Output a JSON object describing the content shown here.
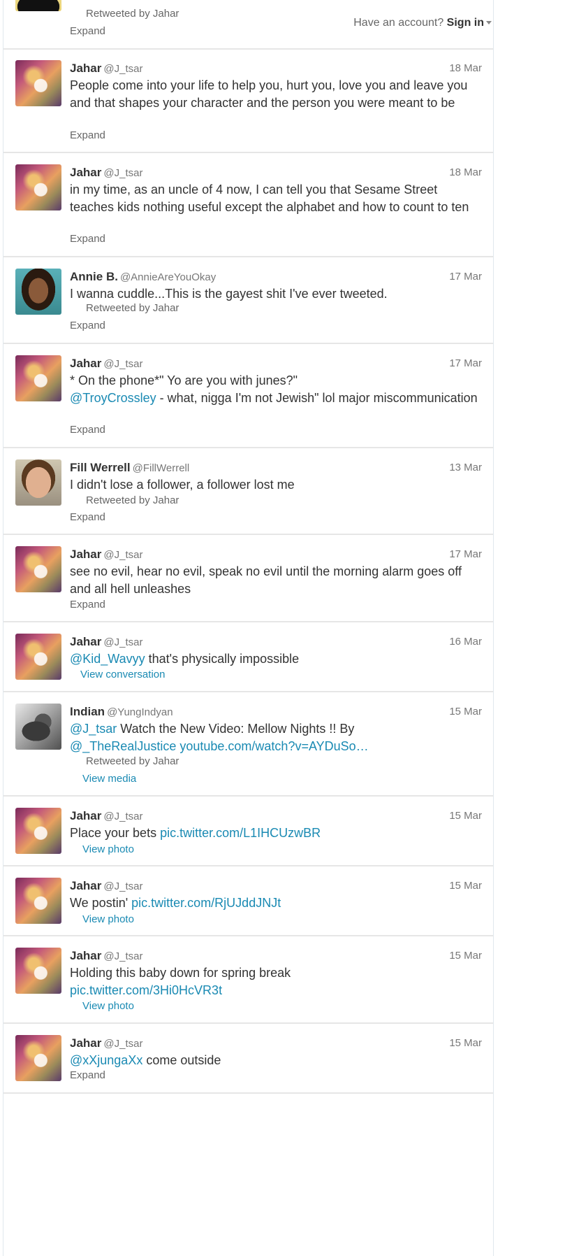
{
  "signin": {
    "prompt": "Have an account?",
    "link": "Sign in"
  },
  "top_partial": {
    "retweeted_by": "Retweeted by Jahar",
    "expand": "Expand"
  },
  "tweets": [
    {
      "fullname": "Jahar",
      "username": "@J_tsar",
      "time": "18 Mar",
      "text": "People come into your life to help you, hurt you, love you and leave you and that shapes your character and the person you were meant to be",
      "expand": "Expand"
    },
    {
      "fullname": "Jahar",
      "username": "@J_tsar",
      "time": "18 Mar",
      "text": "in my time, as an uncle of 4 now, I can tell you that Sesame Street teaches kids nothing useful except the alphabet and how to count to ten",
      "expand": "Expand"
    },
    {
      "fullname": "Annie B.",
      "username": "@AnnieAreYouOkay",
      "time": "17 Mar",
      "text": "I wanna cuddle...This is the gayest shit I've ever tweeted.",
      "retweeted_by": "Retweeted by Jahar",
      "expand": "Expand"
    },
    {
      "fullname": "Jahar",
      "username": "@J_tsar",
      "time": "17 Mar",
      "text_a": "* On the phone*\" Yo are you with junes?\"",
      "mention": "@TroyCrossley",
      "text_b": " - what, nigga I'm not Jewish\" lol major miscommunication",
      "expand": "Expand"
    },
    {
      "fullname": "Fill Werrell",
      "username": "@FillWerrell",
      "time": "13 Mar",
      "text": "I didn't lose a follower, a follower lost me",
      "retweeted_by": "Retweeted by Jahar",
      "expand": "Expand"
    },
    {
      "fullname": "Jahar",
      "username": "@J_tsar",
      "time": "17 Mar",
      "text": "see no evil, hear no evil, speak no evil until the morning alarm goes off and all hell unleashes",
      "expand": "Expand"
    },
    {
      "fullname": "Jahar",
      "username": "@J_tsar",
      "time": "16 Mar",
      "mention": "@Kid_Wavyy",
      "text": " that's physically impossible",
      "view": "View conversation"
    },
    {
      "fullname": "Indian",
      "username": "@YungIndyan",
      "time": "15 Mar",
      "mention_a": "@J_tsar",
      "text_a": " Watch the New Video: Mellow Nights !! By ",
      "mention_b": "@_TheRealJustice",
      "link": "youtube.com/watch?v=AYDuSo…",
      "retweeted_by": "Retweeted by Jahar",
      "view": "View media"
    },
    {
      "fullname": "Jahar",
      "username": "@J_tsar",
      "time": "15 Mar",
      "text": "Place your bets ",
      "link": "pic.twitter.com/L1IHCUzwBR",
      "view": "View photo"
    },
    {
      "fullname": "Jahar",
      "username": "@J_tsar",
      "time": "15 Mar",
      "text": "We postin' ",
      "link": "pic.twitter.com/RjUJddJNJt",
      "view": "View photo"
    },
    {
      "fullname": "Jahar",
      "username": "@J_tsar",
      "time": "15 Mar",
      "text": "Holding this baby down for spring break ",
      "link": "pic.twitter.com/3Hi0HcVR3t",
      "view": "View photo"
    },
    {
      "fullname": "Jahar",
      "username": "@J_tsar",
      "time": "15 Mar",
      "mention": "@xXjungaXx",
      "text": " come outside",
      "expand": "Expand"
    }
  ]
}
